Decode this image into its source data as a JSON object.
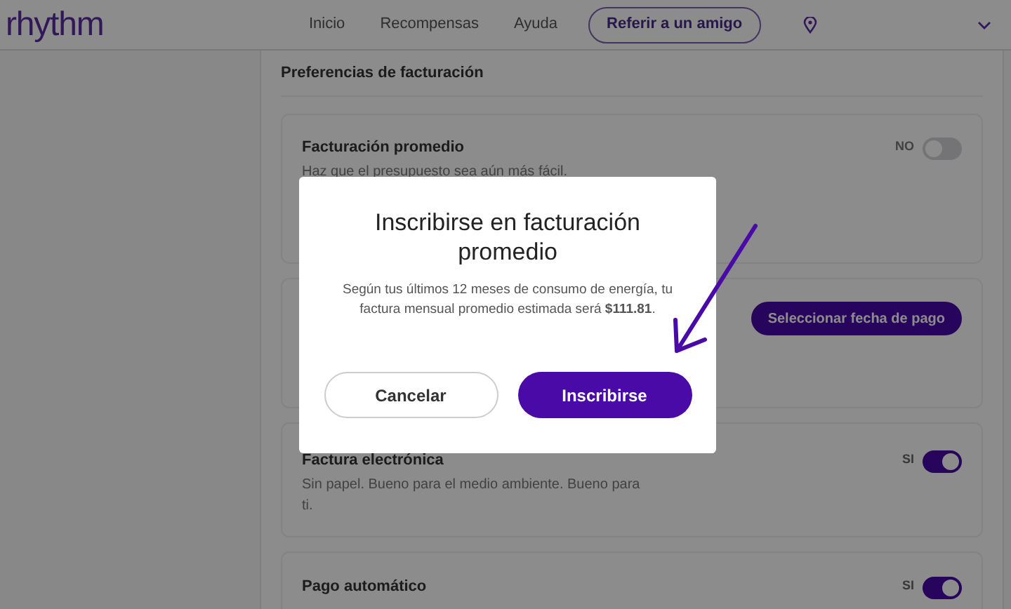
{
  "header": {
    "logo": "rhythm",
    "nav": [
      "Inicio",
      "Recompensas",
      "Ayuda"
    ],
    "cta": "Referir a un amigo"
  },
  "section_title": "Preferencias de facturación",
  "settings": [
    {
      "kind": "toggle",
      "title": "Facturación promedio",
      "description": "Haz que el presupuesto sea aún más fácil.",
      "state_label": "NO",
      "on": false
    },
    {
      "kind": "button",
      "button": "Seleccionar fecha de pago"
    },
    {
      "kind": "toggle",
      "title": "Factura electrónica",
      "description": "Sin papel. Bueno para el medio ambiente. Bueno para ti.",
      "state_label": "SI",
      "on": true
    },
    {
      "kind": "toggle",
      "title": "Pago automático",
      "state_label": "SI",
      "on": true
    }
  ],
  "dialog": {
    "title": "Inscribirse en facturación promedio",
    "body": "Según tus últimos 12 meses de consumo de energía, tu factura mensual promedio estimada será **$111.81**.",
    "buttons": [
      {
        "label": "Cancelar",
        "kind": "secondary"
      },
      {
        "label": "Inscribirse",
        "kind": "primary"
      }
    ]
  }
}
